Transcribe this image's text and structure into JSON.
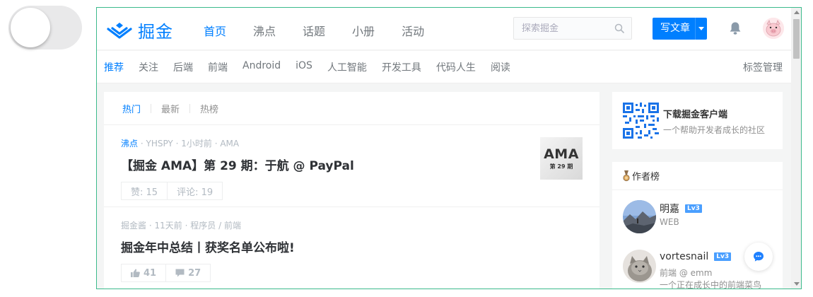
{
  "colors": {
    "brand": "#007fff",
    "frame": "#3cba8c",
    "level_badge": "#4a9fff"
  },
  "header": {
    "logo_text": "掘金",
    "nav": [
      "首页",
      "沸点",
      "话题",
      "小册",
      "活动"
    ],
    "active_nav": "首页",
    "search_placeholder": "探索掘金",
    "write_label": "写文章"
  },
  "categories": {
    "items": [
      "推荐",
      "关注",
      "后端",
      "前端",
      "Android",
      "iOS",
      "人工智能",
      "开发工具",
      "代码人生",
      "阅读"
    ],
    "active": "推荐",
    "manage_label": "标签管理"
  },
  "feed": {
    "tabs": [
      "热门",
      "最新",
      "热榜"
    ],
    "active_tab": "热门",
    "items": [
      {
        "tag": "沸点",
        "author": "YHSPY",
        "time": "1小时前",
        "topic": "AMA",
        "title": "【掘金 AMA】第 29 期：于航 @ PayPal",
        "likes_label": "赞: 15",
        "comments_label": "评论: 19",
        "thumb_big": "AMA",
        "thumb_small": "第 29 期"
      },
      {
        "author": "掘金酱",
        "time": "11天前",
        "role": "程序员",
        "category": "前端",
        "title": "掘金年中总结丨获奖名单公布啦!",
        "likes": "41",
        "comments": "27"
      }
    ]
  },
  "sidebar": {
    "app_title": "下载掘金客户端",
    "app_subtitle": "一个帮助开发者成长的社区",
    "authors_title": "作者榜",
    "authors": [
      {
        "name": "明嘉",
        "level": "Lv3",
        "desc": "WEB"
      },
      {
        "name": "vortesnail",
        "level": "Lv3",
        "desc": "前端 @ emm",
        "desc2": "一个正在成长中的前端菜鸟"
      }
    ]
  }
}
